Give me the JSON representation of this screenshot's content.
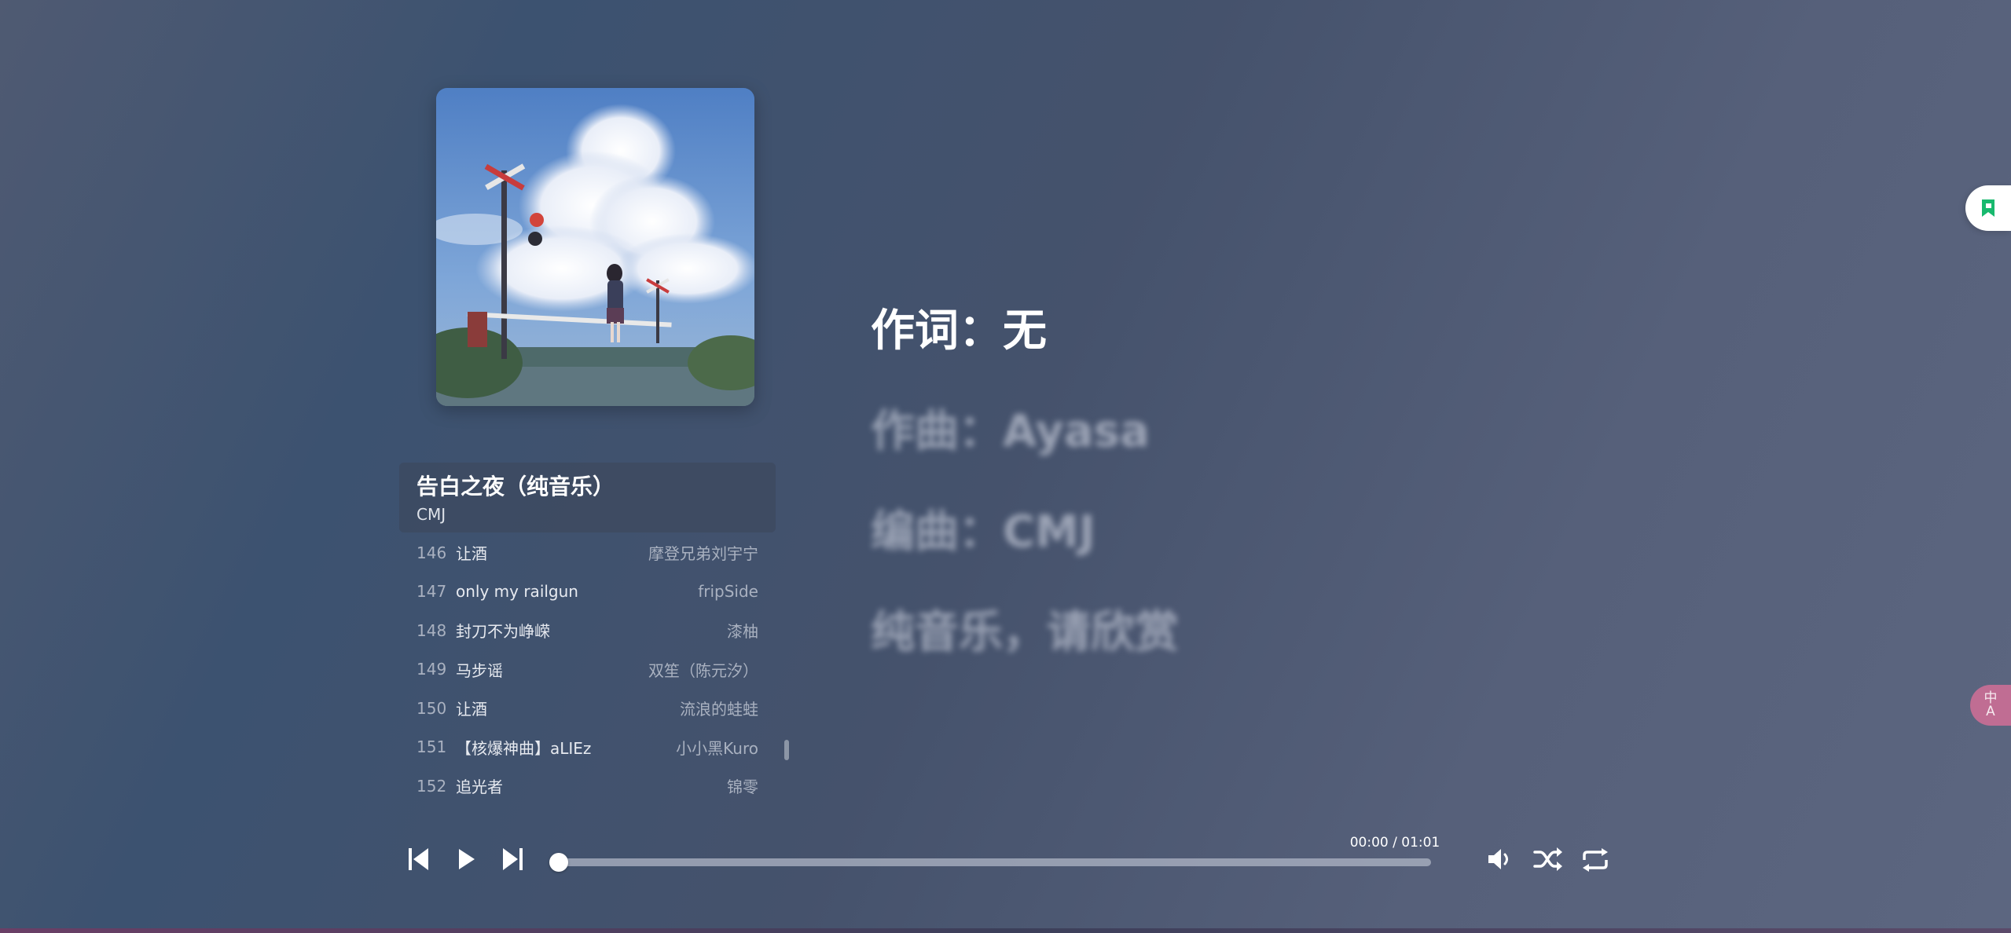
{
  "current_song": {
    "title": "告白之夜（纯音乐）",
    "artist": "CMJ"
  },
  "playlist": [
    {
      "num": "146",
      "title": "让酒",
      "artist": "摩登兄弟刘宇宁"
    },
    {
      "num": "147",
      "title": "only my railgun",
      "artist": "fripSide"
    },
    {
      "num": "148",
      "title": "封刀不为峥嵘",
      "artist": "漆柚"
    },
    {
      "num": "149",
      "title": "马步谣",
      "artist": "双笙（陈元汐）"
    },
    {
      "num": "150",
      "title": "让酒",
      "artist": "流浪的蛙蛙"
    },
    {
      "num": "151",
      "title": "【核爆神曲】aLIEz",
      "artist": "小小黑Kuro"
    },
    {
      "num": "152",
      "title": "追光者",
      "artist": "锦零"
    }
  ],
  "lyrics": [
    "作词：无",
    "作曲：Ayasa",
    "编曲：CMJ",
    "纯音乐，请欣赏"
  ],
  "player": {
    "time": "00:00 / 01:01",
    "progress": 0.0
  },
  "icons": {
    "prev": "skip-previous-icon",
    "play": "play-icon",
    "next": "skip-next-icon",
    "volume": "volume-icon",
    "shuffle": "shuffle-icon",
    "repeat": "repeat-icon",
    "bookmark": "bookmark-icon",
    "translate": "translate-icon"
  },
  "colors": {
    "accent": "#ffffff",
    "bookmark_green": "#18b96e",
    "translate_pink": "#d26e96"
  },
  "widgets": {
    "translate_label_1": "中",
    "translate_label_2": "A"
  }
}
